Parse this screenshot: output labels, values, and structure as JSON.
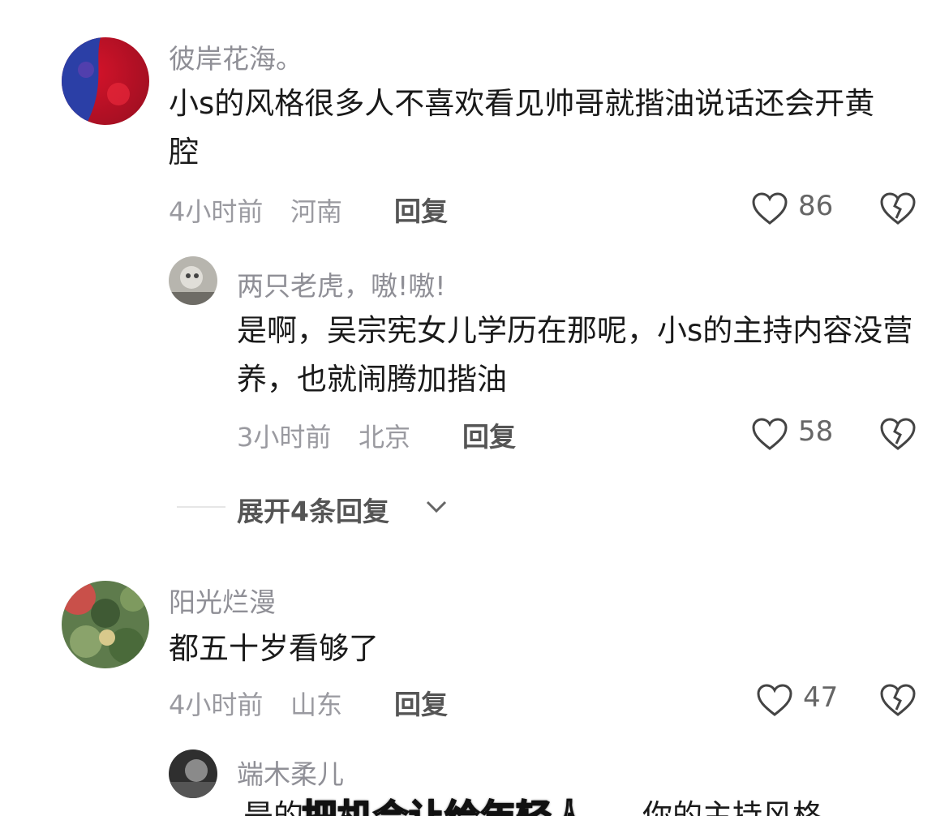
{
  "comments": [
    {
      "username": "彼岸花海。",
      "content": "小s的风格很多人不喜欢看见帅哥就揩油说话还会开黄腔",
      "time": "4小时前",
      "location": "河南",
      "reply_label": "回复",
      "likes": "86",
      "avatar_icon": "avatar-red-blue"
    },
    {
      "username": "两只老虎，嗷!嗷!",
      "content": "是啊，吴宗宪女儿学历在那呢，小s的主持内容没营养，也就闹腾加揩油",
      "time": "3小时前",
      "location": "北京",
      "reply_label": "回复",
      "likes": "58",
      "avatar_icon": "avatar-gray"
    },
    {
      "username": "阳光烂漫",
      "content": "都五十岁看够了",
      "time": "4小时前",
      "location": "山东",
      "reply_label": "回复",
      "likes": "47",
      "avatar_icon": "avatar-green-camo"
    },
    {
      "username": "端木柔儿",
      "content": "是的",
      "avatar_icon": "avatar-dark"
    }
  ],
  "expand_replies": "展开4条回复",
  "overlay_caption": {
    "main": "把机会让给年轻人",
    "trailing": "你的主持风格"
  },
  "icons": [
    "heart-icon",
    "dislike-heart-icon",
    "chevron-down-icon"
  ],
  "colors": {
    "username": "#8f8f96",
    "content": "#1a1a1a",
    "meta": "#9a9aa0"
  }
}
